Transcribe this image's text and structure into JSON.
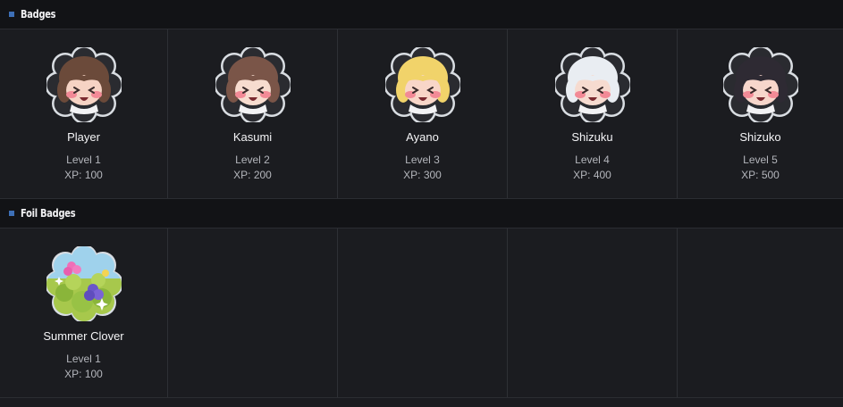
{
  "sections": [
    {
      "title": "Badges",
      "badges": [
        {
          "name": "Player",
          "level": "Level 1",
          "xp": "XP: 100",
          "icon": "chibi-brown-hair-icon",
          "hair": "#6b4a3a",
          "skin": "#f6d3c4"
        },
        {
          "name": "Kasumi",
          "level": "Level 2",
          "xp": "XP: 200",
          "icon": "chibi-kasumi-icon",
          "hair": "#7a5548",
          "skin": "#f7dccf"
        },
        {
          "name": "Ayano",
          "level": "Level 3",
          "xp": "XP: 300",
          "icon": "chibi-blonde-icon",
          "hair": "#f1d36a",
          "skin": "#f8d6c8"
        },
        {
          "name": "Shizuku",
          "level": "Level 4",
          "xp": "XP: 400",
          "icon": "chibi-white-hair-icon",
          "hair": "#e9edf2",
          "skin": "#f6dbd0"
        },
        {
          "name": "Shizuko",
          "level": "Level 5",
          "xp": "XP: 500",
          "icon": "chibi-dark-hair-icon",
          "hair": "#2e2a33",
          "skin": "#f7d6cb"
        }
      ]
    },
    {
      "title": "Foil Badges",
      "badges": [
        {
          "name": "Summer Clover",
          "level": "Level 1",
          "xp": "XP: 100",
          "icon": "clover-flower-icon"
        }
      ]
    }
  ]
}
